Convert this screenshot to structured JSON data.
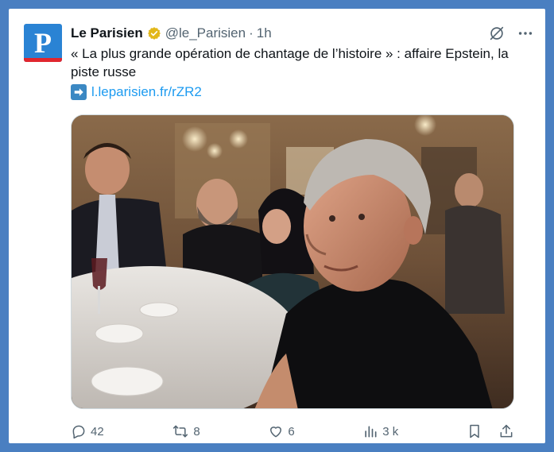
{
  "tweet": {
    "author_name": "Le Parisien",
    "avatar_letter": "P",
    "handle": "@le_Parisien",
    "separator": "·",
    "time": "1h",
    "text": "« La plus grande opération de chantage de l’histoire » : affaire Epstein, la piste russe",
    "link_text": "l.leparisien.fr/rZR2"
  },
  "stats": {
    "replies": "42",
    "retweets": "8",
    "likes": "6",
    "views": "3 k"
  },
  "icons": {
    "verified": "verified-badge-icon",
    "grok": "grok-icon",
    "more": "more-icon",
    "arrow": "right-arrow-icon",
    "reply": "reply-icon",
    "retweet": "retweet-icon",
    "like": "heart-icon",
    "views": "views-icon",
    "bookmark": "bookmark-icon",
    "share": "share-icon"
  },
  "colors": {
    "page_border": "#4a7fc1",
    "avatar_bg": "#2a83d4",
    "avatar_stripe": "#e0262f",
    "verified_gold": "#e2b719",
    "link": "#1d9bf0",
    "muted": "#536471",
    "text": "#0f1419"
  }
}
